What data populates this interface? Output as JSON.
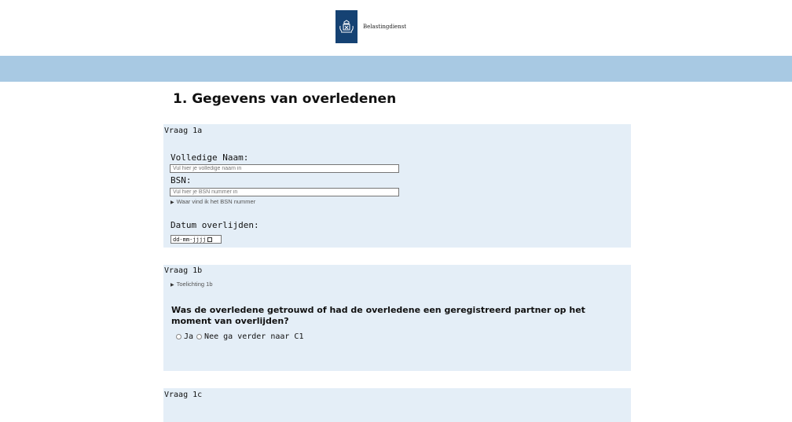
{
  "header": {
    "logo_text": "Belastingdienst"
  },
  "page": {
    "title": "1. Gegevens van overledenen"
  },
  "section_1a": {
    "label": "Vraag 1a",
    "name_label": "Volledige Naam:",
    "name_placeholder": "Vul hier je volledige naam in",
    "bsn_label": "BSN:",
    "bsn_placeholder": "Vul hier je BSN nummer in",
    "bsn_help": "Waar vind ik het BSN nummer",
    "date_label": "Datum overlijden:",
    "date_placeholder": "dd-mm-jjjj"
  },
  "section_1b": {
    "label": "Vraag 1b",
    "toelichting": "Toelichting 1b",
    "question": "Was de overledene getrouwd of had de overledene een geregistreerd partner op het moment van overlijden?",
    "options": [
      "Ja",
      "Nee ga verder naar C1"
    ]
  },
  "section_1c": {
    "label": "Vraag 1c"
  },
  "colors": {
    "band": "#a8c9e3",
    "card": "#e4eef7",
    "logo": "#154273"
  },
  "icons": {
    "logo": "crest-icon",
    "disclosure": "triangle-right-icon",
    "calendar": "calendar-icon"
  }
}
